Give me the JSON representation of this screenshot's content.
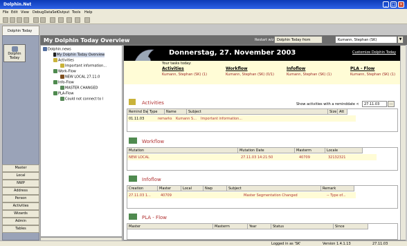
{
  "window": {
    "title": "Dolphin.Net",
    "min": "_",
    "max": "□",
    "close": "×"
  },
  "menu": [
    "File",
    "Edit",
    "View",
    "DebugDataSet",
    "Output",
    "Tools",
    "Help"
  ],
  "nav": {
    "tab": "Dolphin Today",
    "top_button": "Dolphin Today",
    "buttons": [
      "Master",
      "Local",
      "NWP",
      "Address",
      "Person",
      "Activities",
      "Wizards",
      "Admin",
      "Tables"
    ]
  },
  "header": {
    "title": "My Dolphin Today Overview",
    "wizard": "Restart wizard",
    "tab": "Dolphin Today from",
    "user": "Kumann, Stephan (SK)",
    "dropdown": "▼"
  },
  "tree": {
    "root": "Dolphin.news",
    "items": [
      "My Dolphin Today Overview",
      "Activities",
      "Important information...",
      "Work-Flow",
      "NEW LOCAL 27.11.0",
      "Info-Flow",
      "MASTER CHANGED",
      "PLA-Flow",
      "Could not connect to l"
    ]
  },
  "banner": {
    "date": "Donnerstag, 27. November 2003",
    "customize": "Customize Dolphin Today"
  },
  "tasks": {
    "label": "Your tasks today:",
    "cols": [
      {
        "head": "Activities",
        "value": "Kumann, Stephan (SK) (1)"
      },
      {
        "head": "Workflow",
        "value": "Kumann, Stephan (SK) (0/1)"
      },
      {
        "head": "Infoflow",
        "value": "Kumann, Stephan (SK) (1)"
      },
      {
        "head": "PLA - Flow",
        "value": "Kumann, Stephan (SK) (1)"
      }
    ]
  },
  "activities": {
    "title": "Activities",
    "filter_label": "Show activities with a reminddate <",
    "filter_value": "27.11.03",
    "filter_btn": "...",
    "headers": [
      "Remind Date",
      "Type",
      "Name",
      "Subject",
      "Size",
      "Att"
    ],
    "row": [
      "01.11.03",
      "remarks",
      "Kumann S...",
      "Important information...",
      "",
      ""
    ]
  },
  "workflow": {
    "title": "Workflow",
    "headers": [
      "Mutation",
      "Mutation Date",
      "Masterm",
      "Locale"
    ],
    "row": [
      "NEW LOCAL",
      "27.11.03 14:21:50",
      "40709",
      "32132321"
    ]
  },
  "infoflow": {
    "title": "Infoflow",
    "headers": [
      "Creation",
      "Master",
      "Local",
      "Nwp",
      "Subject",
      "Remark"
    ],
    "row": [
      "27.11.03 1...",
      "40709",
      "",
      "",
      "Master Segmentation Changed",
      "-- Type of..."
    ]
  },
  "plaflow": {
    "title": "PLA - Flow",
    "headers": [
      "Master",
      "Masterm",
      "Year",
      "Status",
      "Since"
    ]
  },
  "status": {
    "login": "Logged in as 'SK'",
    "version": "Version 1.4.1.13",
    "date": "27.11.03"
  }
}
